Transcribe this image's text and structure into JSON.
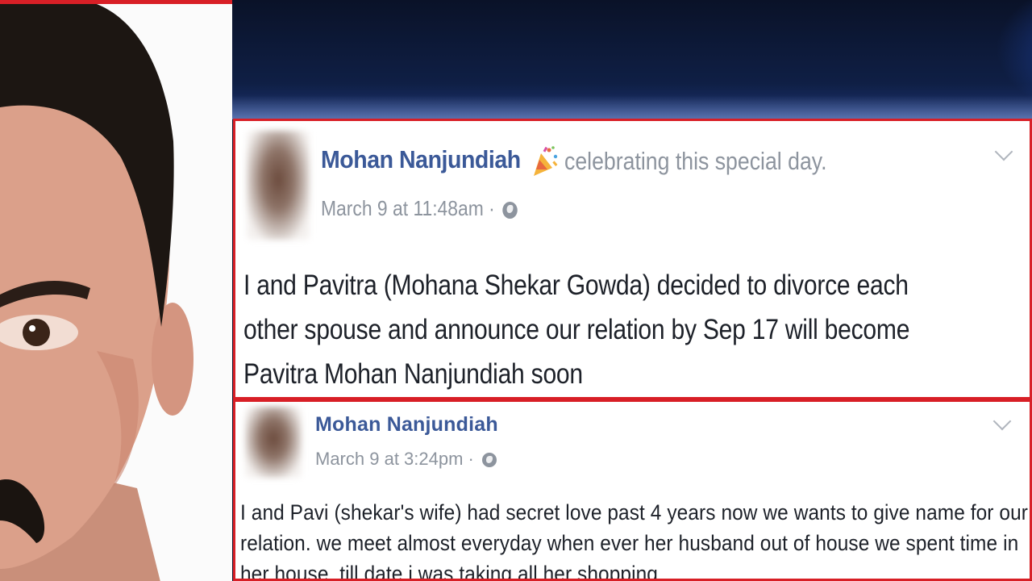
{
  "posts": [
    {
      "author": "Mohan Nanjundiah",
      "activity": "celebrating this special day.",
      "timestamp": "March 9 at 11:48am ·",
      "body": "I and Pavitra (Mohana Shekar Gowda) decided to divorce each other spouse and announce our relation by Sep 17 will become Pavitra Mohan Nanjundiah soon"
    },
    {
      "author": "Mohan Nanjundiah",
      "timestamp": "March 9 at 3:24pm ·",
      "body": "I and Pavi (shekar's wife) had secret love past 4 years now we wants to give name for our relation. we meet almost everyday when ever her husband out of house we spent time in her house. till date i was taking all her shopping"
    }
  ],
  "icons": {
    "party": "party-popper-icon",
    "privacy": "globe-icon",
    "menu": "chevron-down-icon"
  },
  "colors": {
    "highlight_border": "#d81f26",
    "author_link": "#3b5998",
    "meta_text": "#8d949e"
  }
}
